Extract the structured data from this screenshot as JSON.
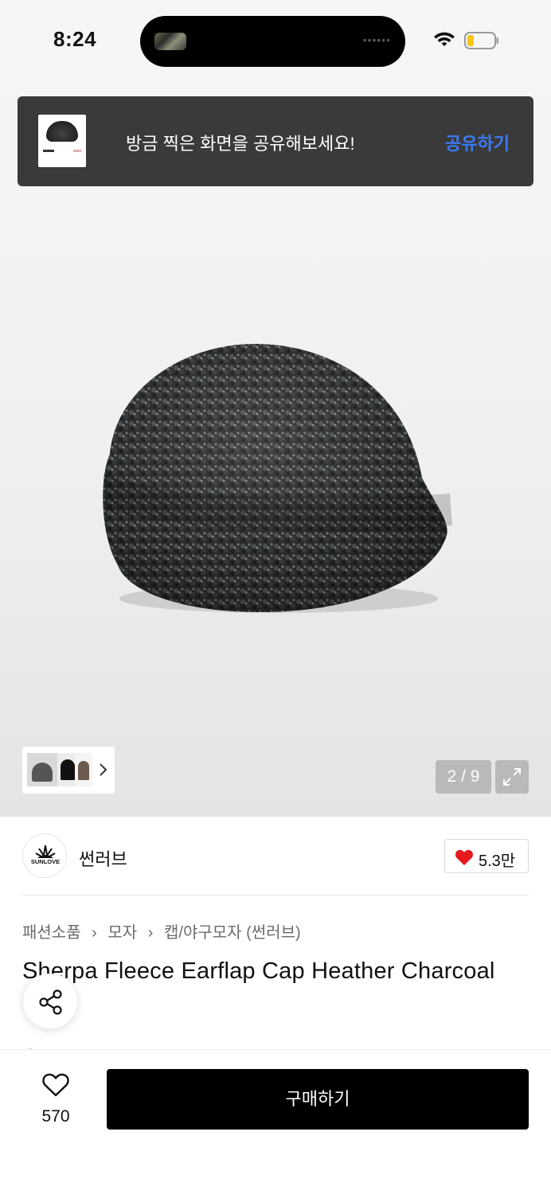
{
  "status_bar": {
    "time": "8:24"
  },
  "toast": {
    "message": "방금 찍은 화면을 공유해보세요!",
    "action": "공유하기"
  },
  "gallery": {
    "counter": "2 / 9"
  },
  "brand": {
    "name": "썬러브",
    "logo_text": "SUNLOVE",
    "likes": "5.3만"
  },
  "breadcrumb": {
    "items": [
      "패션소품",
      "모자",
      "캡/야구모자 (썬러브)"
    ],
    "separator": "›"
  },
  "product": {
    "title": "Sherpa Fleece Earflap Cap Heather Charcoal"
  },
  "bottom_bar": {
    "wish_count": "570",
    "buy_label": "구매하기"
  },
  "colors": {
    "accent_link": "#3b7bf5",
    "heart": "#e5191b",
    "buy_button": "#000000"
  }
}
